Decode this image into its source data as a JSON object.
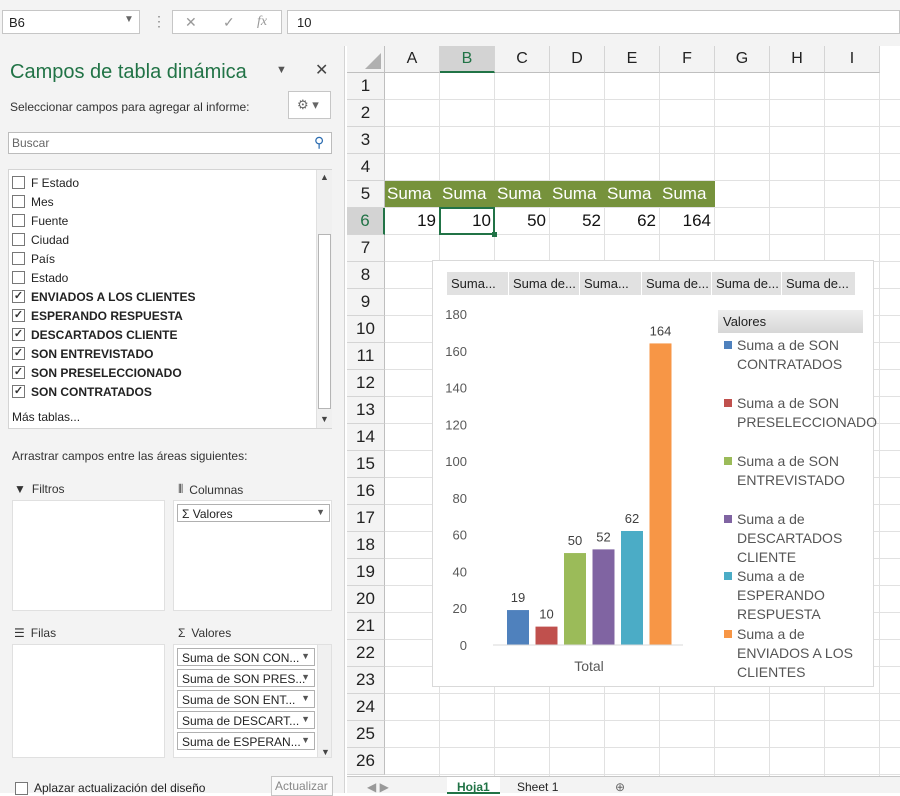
{
  "formula_bar": {
    "name_box": "B6",
    "formula": "10",
    "cancel_icon": "✕",
    "enter_icon": "✓",
    "fx_label": "fx"
  },
  "pane": {
    "title": "Campos de tabla dinámica",
    "hint": "Seleccionar campos para agregar al informe:",
    "search_placeholder": "Buscar",
    "fields": [
      {
        "label": "F Estado",
        "checked": false
      },
      {
        "label": "Mes",
        "checked": false
      },
      {
        "label": "Fuente",
        "checked": false
      },
      {
        "label": "Ciudad",
        "checked": false
      },
      {
        "label": "País",
        "checked": false
      },
      {
        "label": "Estado",
        "checked": false
      },
      {
        "label": "ENVIADOS A LOS CLIENTES",
        "checked": true
      },
      {
        "label": "ESPERANDO RESPUESTA",
        "checked": true
      },
      {
        "label": "DESCARTADOS CLIENTE",
        "checked": true
      },
      {
        "label": "SON ENTREVISTADO",
        "checked": true
      },
      {
        "label": "SON PRESELECCIONADO",
        "checked": true
      },
      {
        "label": "SON CONTRATADOS",
        "checked": true
      }
    ],
    "more_tables": "Más tablas...",
    "drag_hint": "Arrastrar campos entre las áreas siguientes:",
    "areas": {
      "filters": "Filtros",
      "columns": "Columnas",
      "rows": "Filas",
      "values": "Valores"
    },
    "column_chips": [
      "Valores"
    ],
    "value_chips": [
      "Suma de SON CON...",
      "Suma de SON PRES...",
      "Suma de SON ENT...",
      "Suma de DESCART...",
      "Suma de ESPERAN..."
    ],
    "defer_label": "Aplazar actualización del diseño",
    "update_button": "Actualizar"
  },
  "grid": {
    "columns": [
      "A",
      "B",
      "C",
      "D",
      "E",
      "F",
      "G",
      "H",
      "I"
    ],
    "selected_column": "B",
    "rows": [
      "1",
      "2",
      "3",
      "4",
      "5",
      "6",
      "7",
      "8",
      "9",
      "10",
      "11",
      "12",
      "13",
      "14",
      "15",
      "16",
      "17",
      "18",
      "19",
      "20",
      "21",
      "22",
      "23",
      "24",
      "25",
      "26"
    ],
    "selected_row": "6",
    "header_cells": [
      "Suma",
      "Suma",
      "Suma",
      "Suma",
      "Suma",
      "Suma"
    ],
    "value_cells": [
      "19",
      "10",
      "50",
      "52",
      "62",
      "164"
    ],
    "sheet_tabs": [
      "Hoja1",
      "Sheet 1"
    ],
    "header_fill": "#76923c",
    "accent": "#217346"
  },
  "chart": {
    "field_buttons": [
      "Suma...",
      "Suma de...",
      "Suma...",
      "Suma de...",
      "Suma de...",
      "Suma de..."
    ],
    "legend_title": "Valores",
    "legend_items": [
      "Suma a de SON CONTRATADOS",
      "Suma a de SON PRESELECCIONADO",
      "Suma a de SON ENTREVISTADO",
      "Suma a de DESCARTADOS CLIENTE",
      "Suma a de ESPERANDO RESPUESTA",
      "Suma a de ENVIADOS A LOS CLIENTES"
    ]
  },
  "chart_data": {
    "type": "bar",
    "categories": [
      "Total"
    ],
    "series": [
      {
        "name": "Suma a de SON CONTRATADOS",
        "values": [
          19
        ],
        "color": "#4f81bd"
      },
      {
        "name": "Suma a de SON PRESELECCIONADO",
        "values": [
          10
        ],
        "color": "#c0504d"
      },
      {
        "name": "Suma a de SON ENTREVISTADO",
        "values": [
          50
        ],
        "color": "#9bbb59"
      },
      {
        "name": "Suma a de DESCARTADOS CLIENTE",
        "values": [
          52
        ],
        "color": "#8064a2"
      },
      {
        "name": "Suma a de ESPERANDO RESPUESTA",
        "values": [
          62
        ],
        "color": "#4bacc6"
      },
      {
        "name": "Suma a de ENVIADOS A LOS CLIENTES",
        "values": [
          164
        ],
        "color": "#f79646"
      }
    ],
    "yticks": [
      "0",
      "20",
      "40",
      "60",
      "80",
      "100",
      "120",
      "140",
      "160",
      "180"
    ],
    "ylim": [
      0,
      180
    ],
    "legend": "right",
    "grid": false
  }
}
